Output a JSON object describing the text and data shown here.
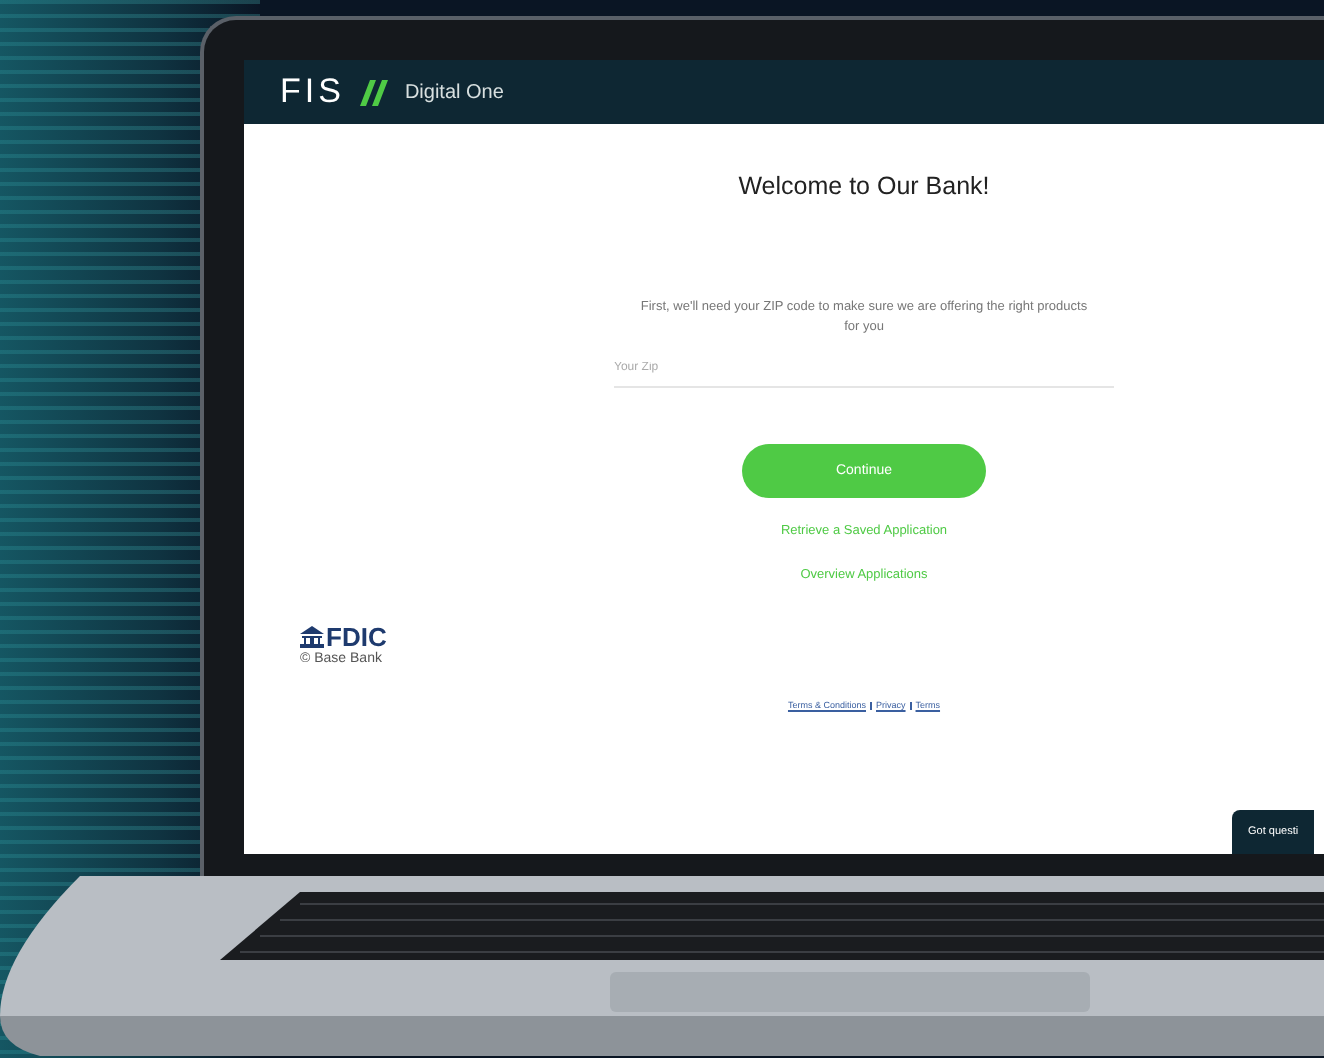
{
  "header": {
    "logo": "FIS",
    "product": "Digital One"
  },
  "title": "Welcome to Our Bank!",
  "intro": "First, we'll need your ZIP code to make sure we are offering the right products for you",
  "zip_field": {
    "placeholder": "Your Zip"
  },
  "continue_button": "Continue",
  "links": [
    "Retrieve a Saved Application",
    "Overview Applications"
  ],
  "fdic": {
    "logo": "FDIC",
    "bank": "© Base Bank"
  },
  "footer_links": [
    "Terms & Conditions",
    "Privacy",
    "Terms"
  ],
  "chat_button": "Got questi"
}
